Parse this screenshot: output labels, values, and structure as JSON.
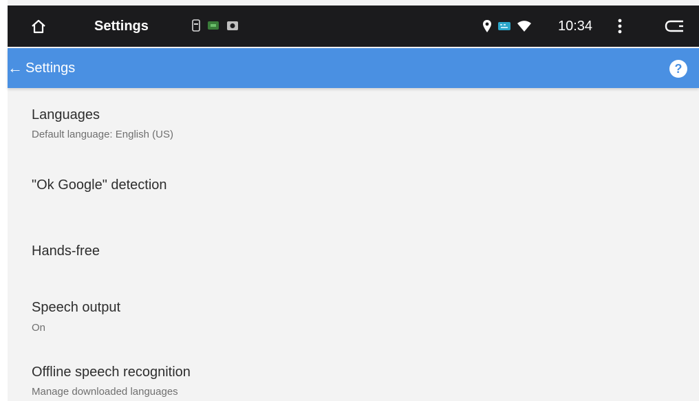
{
  "status_bar": {
    "app_title": "Settings",
    "clock": "10:34",
    "notification_icons": [
      "sd-card-icon",
      "android-debug-icon",
      "photo-icon"
    ],
    "system_icons": [
      "location-icon",
      "keyboard-icon",
      "wifi-icon"
    ]
  },
  "action_bar": {
    "title": "Settings",
    "help_label": "?"
  },
  "settings": {
    "items": [
      {
        "title": "Languages",
        "summary": "Default language: English (US)"
      },
      {
        "title": "\"Ok Google\" detection",
        "summary": ""
      },
      {
        "title": "Hands-free",
        "summary": ""
      },
      {
        "title": "Speech output",
        "summary": "On"
      },
      {
        "title": "Offline speech recognition",
        "summary": "Manage downloaded languages"
      }
    ]
  },
  "colors": {
    "action_bar": "#4a90e2",
    "status_bar": "#1b1b1d",
    "background": "#f3f3f3"
  }
}
